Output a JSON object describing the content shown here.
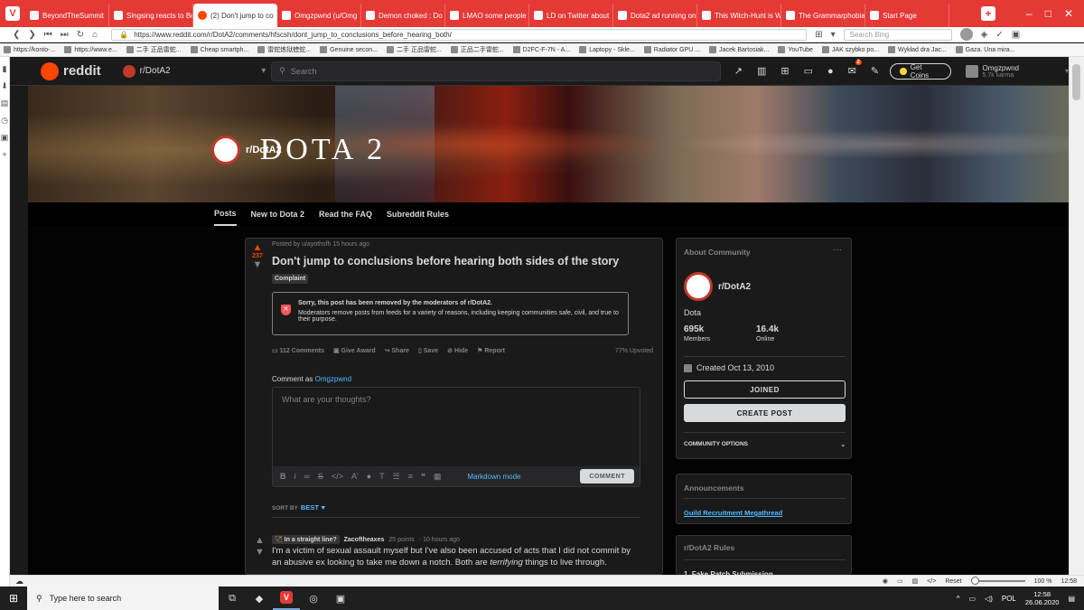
{
  "browser": {
    "tabs": [
      {
        "title": "BeyondTheSummit",
        "active": false
      },
      {
        "title": "Singsing reacts to Bo",
        "active": false
      },
      {
        "title": "(2) Don't jump to co",
        "active": true
      },
      {
        "title": "Omgzpwnd (u/Omg",
        "active": false
      },
      {
        "title": "Demon choked : Do",
        "active": false
      },
      {
        "title": "LMAO some people",
        "active": false
      },
      {
        "title": "LD on Twitter about",
        "active": false
      },
      {
        "title": "Dota2 ad running on",
        "active": false
      },
      {
        "title": "This Witch-Hunt is W",
        "active": false
      },
      {
        "title": "The Grammarphobia",
        "active": false
      },
      {
        "title": "Start Page",
        "active": false
      }
    ],
    "url": "https://www.reddit.com/r/DotA2/comments/hfscsh/dont_jump_to_conclusions_before_hearing_both/",
    "search_placeholder": "Search Bing",
    "bookmarks": [
      "https://konto-...",
      "https://www.e...",
      "二手 正品雷蛇...",
      "Cheap smartph...",
      "雷蛇炼狱蝰蛇...",
      "Genuine secon...",
      "二手 正品雷蛇...",
      "正品二手雷蛇...",
      "D2FC-F-7N - A...",
      "Laptopy - Skle...",
      "Radiator GPU ...",
      "Jacek Bartosiak...",
      "YouTube",
      "JAK szybko po...",
      "Wykład dra Jac...",
      "Gaza. Una mira..."
    ],
    "zoom_reset": "Reset",
    "zoom_level": "100 %",
    "status_time": "12:58"
  },
  "reddit": {
    "logo_text": "reddit",
    "subreddit_selector": "r/DotA2",
    "search_placeholder": "Search",
    "notif_badge": "2",
    "get_coins": "Get Coins",
    "username": "Omgzpwnd",
    "karma": "5.7k karma",
    "banner_sub": "r/DotA2",
    "banner_title": "DOTA 2",
    "nav": [
      "Posts",
      "New to Dota 2",
      "Read the FAQ",
      "Subreddit Rules"
    ]
  },
  "post": {
    "votes": "237",
    "meta": "Posted by u/ayothsfh 15 hours ago",
    "title": "Don't jump to conclusions before hearing both sides of the story",
    "flair": "Complaint",
    "removed_title": "Sorry, this post has been removed by the moderators of r/DotA2.",
    "removed_body": "Moderators remove posts from feeds for a variety of reasons, including keeping communities safe, civil, and true to their purpose.",
    "actions": {
      "comments": "112 Comments",
      "award": "Give Award",
      "share": "Share",
      "save": "Save",
      "hide": "Hide",
      "report": "Report"
    },
    "upvoted": "77% Upvoted",
    "comment_as_label": "Comment as",
    "comment_as_user": "Omgzpwnd",
    "comment_placeholder": "What are your thoughts?",
    "markdown_mode": "Markdown mode",
    "comment_button": "COMMENT",
    "sort_label": "SORT BY",
    "sort_value": "BEST"
  },
  "comment": {
    "user_flair": "In a straight line?",
    "author": "Zacoftheaxes",
    "points": "25 points",
    "time": "· 10 hours ago",
    "text_before": "I'm a victim of sexual assault myself but I've also been accused of acts that I did not commit by an abusive ex looking to take me down a notch. Both are ",
    "text_em": "terrifying",
    "text_after": " things to live through."
  },
  "sidebar": {
    "about_title": "About Community",
    "sub_name": "r/DotA2",
    "description": "Dota",
    "members_count": "695k",
    "members_label": "Members",
    "online_count": "16.4k",
    "online_label": "Online",
    "created": "Created Oct 13, 2010",
    "joined_button": "JOINED",
    "create_post_button": "CREATE POST",
    "community_options": "COMMUNITY OPTIONS",
    "announcements_title": "Announcements",
    "announcement_link": "Guild Recruitment Megathread",
    "rules_title": "r/DotA2 Rules",
    "rule_1": "1. Fake Patch Submission"
  },
  "taskbar": {
    "search_placeholder": "Type here to search",
    "language": "POL",
    "time": "12:58",
    "date": "26.06.2020"
  },
  "colors": {
    "reddit_orange": "#ff4500",
    "vivaldi_red": "#e53935",
    "link_blue": "#4fbcff",
    "dark_bg": "#1a1a1b"
  }
}
